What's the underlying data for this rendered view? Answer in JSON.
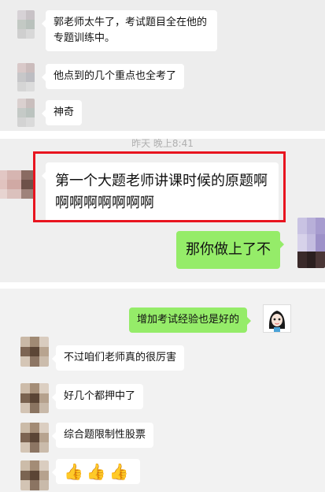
{
  "panel1": {
    "messages": [
      {
        "text": "郭老师太牛了，考试题目全在他的专题训练中。"
      },
      {
        "text": "他点到的几个重点也全考了"
      },
      {
        "text": "神奇"
      }
    ]
  },
  "panel2": {
    "timestamp": "昨天 晚上8:41",
    "received": {
      "text": "第一个大题老师讲课时候的原题啊啊啊啊啊啊啊啊"
    },
    "sent": {
      "text": "那你做上了不"
    }
  },
  "panel3": {
    "sent": {
      "text": "增加考试经验也是好的"
    },
    "messages": [
      {
        "text": "不过咱们老师真的很厉害"
      },
      {
        "text": "好几个都押中了"
      },
      {
        "text": "综合题限制性股票"
      },
      {
        "text": "👍👍👍"
      }
    ]
  },
  "colors": {
    "bubble_green": "#95ec69",
    "highlight_red": "#e8141f",
    "chat_background": "#ededed"
  }
}
